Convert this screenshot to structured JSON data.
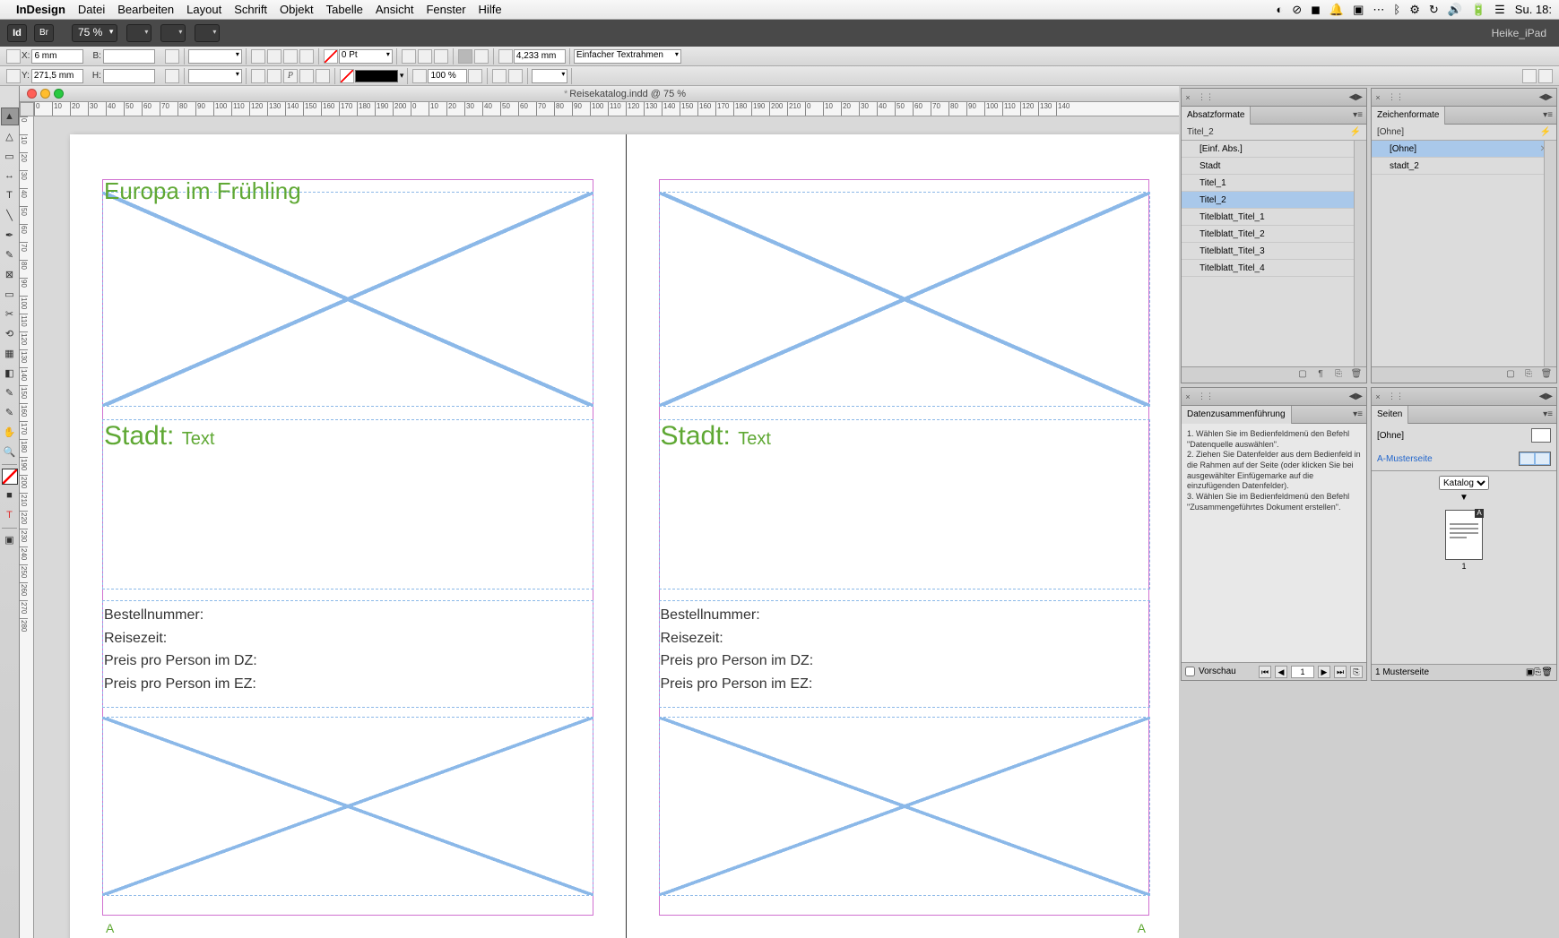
{
  "menubar": {
    "app": "InDesign",
    "items": [
      "Datei",
      "Bearbeiten",
      "Layout",
      "Schrift",
      "Objekt",
      "Tabelle",
      "Ansicht",
      "Fenster",
      "Hilfe"
    ],
    "clock": "Su. 18:"
  },
  "appctrl": {
    "zoom": "75 %",
    "user": "Heike_iPad"
  },
  "options": {
    "x": "6 mm",
    "y": "271,5 mm",
    "b": "",
    "h": "",
    "stroke_pt": "0 Pt",
    "measure": "4,233 mm",
    "percent": "100 %",
    "fit_label": "Einfacher Textrahmen"
  },
  "window": {
    "title": "Reisekatalog.indd @ 75 %",
    "dirty": "*"
  },
  "doc": {
    "page_title": "Europa im Frühling",
    "stadt_label": "Stadt:",
    "stadt_value": "Text",
    "lines": {
      "bestell": "Bestellnummer:",
      "reisezeit": "Reisezeit:",
      "preis_dz": "Preis pro Person im DZ:",
      "preis_ez": "Preis pro Person im EZ:"
    },
    "section_marker": "A"
  },
  "panels": {
    "absatz": {
      "title": "Absatzformate",
      "current": "Titel_2",
      "items": [
        "[Einf. Abs.]",
        "Stadt",
        "Titel_1",
        "Titel_2",
        "Titelblatt_Titel_1",
        "Titelblatt_Titel_2",
        "Titelblatt_Titel_3",
        "Titelblatt_Titel_4"
      ],
      "selected_index": 3
    },
    "zeichen": {
      "title": "Zeichenformate",
      "current": "[Ohne]",
      "items": [
        "[Ohne]",
        "stadt_2"
      ],
      "selected_index": 0
    },
    "merge": {
      "title": "Datenzusammenführung",
      "instructions": "1. Wählen Sie im Bedienfeldmenü den Befehl \"Datenquelle auswählen\".\n2. Ziehen Sie Datenfelder aus dem Bedienfeld in die Rahmen auf der Seite (oder klicken Sie bei ausgewählter Einfügemarke auf die einzufügenden Datenfelder).\n3. Wählen Sie im Bedienfeldmenü den Befehl \"Zusammengeführtes Dokument erstellen\".",
      "preview_label": "Vorschau",
      "page": "1"
    },
    "seiten": {
      "title": "Seiten",
      "none": "[Ohne]",
      "a_master": "A-Musterseite",
      "layout_sel": "Katalog",
      "page_num": "1",
      "master_ind": "A",
      "status": "1 Musterseite"
    }
  },
  "ruler_ticks_h": [
    "0",
    "10",
    "20",
    "30",
    "40",
    "50",
    "60",
    "70",
    "80",
    "90",
    "100",
    "110",
    "120",
    "130",
    "140",
    "150",
    "160",
    "170",
    "180",
    "190",
    "200",
    "0",
    "10",
    "20",
    "30",
    "40",
    "50",
    "60",
    "70",
    "80",
    "90",
    "100",
    "110",
    "120",
    "130",
    "140",
    "150",
    "160",
    "170",
    "180",
    "190",
    "200",
    "210",
    "0",
    "10",
    "20",
    "30",
    "40",
    "50",
    "60",
    "70",
    "80",
    "90",
    "100",
    "110",
    "120",
    "130",
    "140"
  ],
  "ruler_ticks_v": [
    "0",
    "10",
    "20",
    "30",
    "40",
    "50",
    "60",
    "70",
    "80",
    "90",
    "100",
    "110",
    "120",
    "130",
    "140",
    "150",
    "160",
    "170",
    "180",
    "190",
    "200",
    "210",
    "220",
    "230",
    "240",
    "250",
    "260",
    "270",
    "280"
  ]
}
